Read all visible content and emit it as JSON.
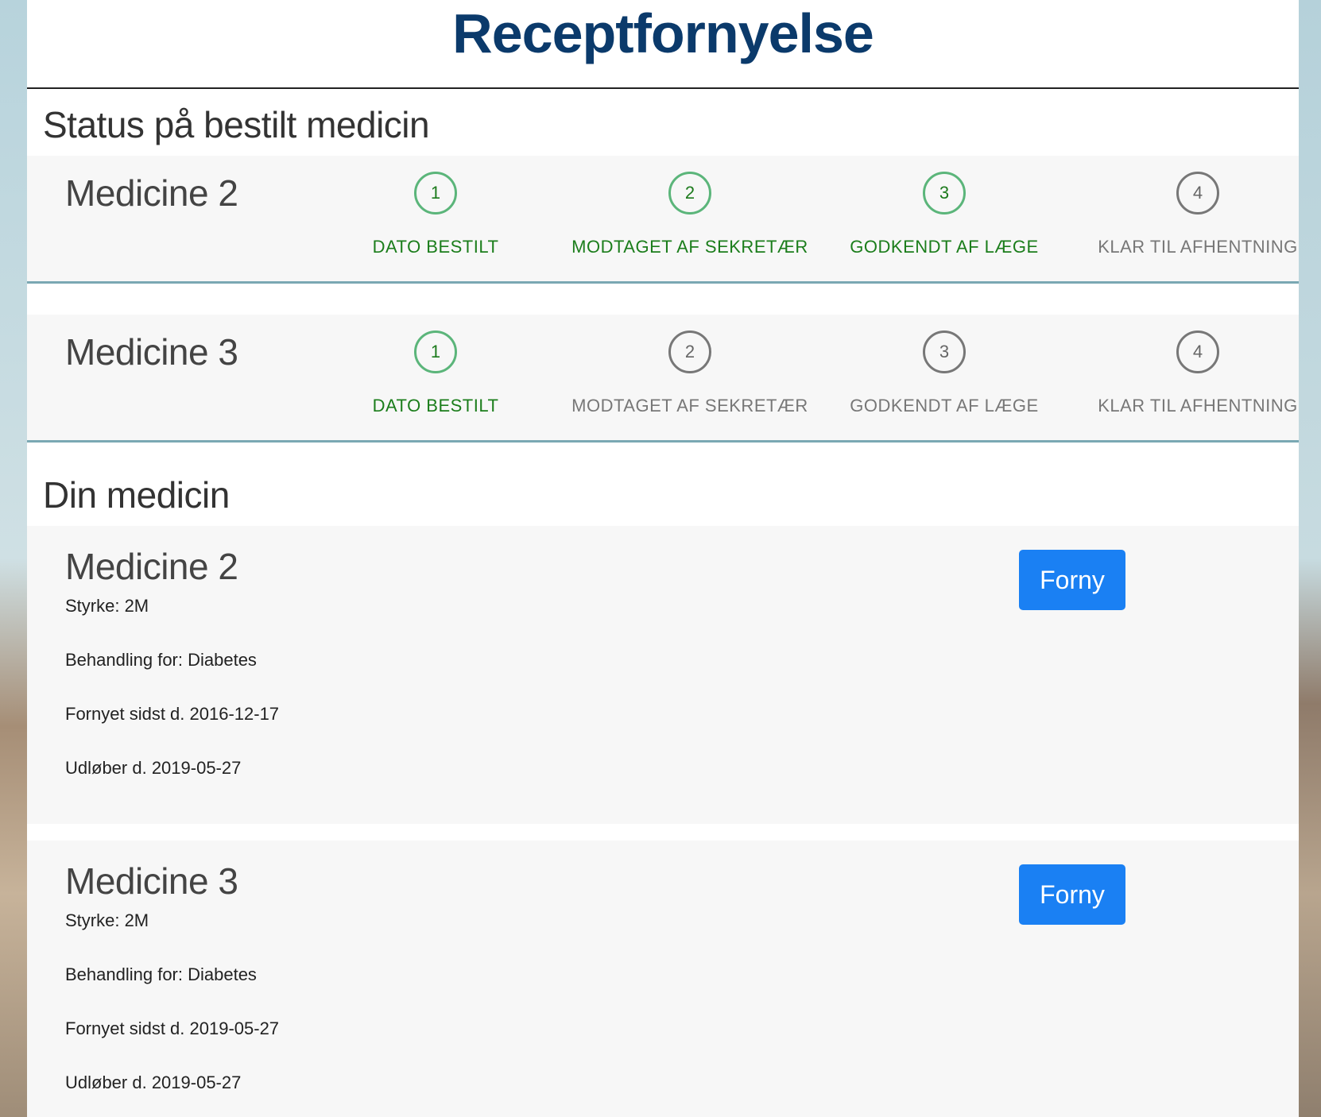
{
  "page": {
    "title": "Receptfornyelse"
  },
  "status_section": {
    "heading": "Status på bestilt medicin",
    "orders": [
      {
        "name": "Medicine 2",
        "steps": [
          {
            "number": "1",
            "label": "DATO BESTILT",
            "done": true
          },
          {
            "number": "2",
            "label": "MODTAGET AF SEKRETÆR",
            "done": true
          },
          {
            "number": "3",
            "label": "GODKENDT AF LÆGE",
            "done": true
          },
          {
            "number": "4",
            "label": "KLAR TIL AFHENTNING",
            "done": false
          }
        ]
      },
      {
        "name": "Medicine 3",
        "steps": [
          {
            "number": "1",
            "label": "DATO BESTILT",
            "done": true
          },
          {
            "number": "2",
            "label": "MODTAGET AF SEKRETÆR",
            "done": false
          },
          {
            "number": "3",
            "label": "GODKENDT AF LÆGE",
            "done": false
          },
          {
            "number": "4",
            "label": "KLAR TIL AFHENTNING",
            "done": false
          }
        ]
      }
    ]
  },
  "medicine_section": {
    "heading": "Din medicin",
    "items": [
      {
        "name": "Medicine 2",
        "strength": "Styrke: 2M",
        "treatment": "Behandling for: Diabetes",
        "renewed": "Fornyet sidst d. 2016-12-17",
        "expires": "Udløber d. 2019-05-27",
        "button_label": "Forny"
      },
      {
        "name": "Medicine 3",
        "strength": "Styrke: 2M",
        "treatment": "Behandling for: Diabetes",
        "renewed": "Fornyet sidst d. 2019-05-27",
        "expires": "Udløber d. 2019-05-27",
        "button_label": "Forny"
      }
    ]
  },
  "colors": {
    "title": "#0b3a6b",
    "step_done": "#1b7d1b",
    "step_pending": "#777777",
    "button": "#1a80f3",
    "card_border": "#7aa8b3"
  }
}
